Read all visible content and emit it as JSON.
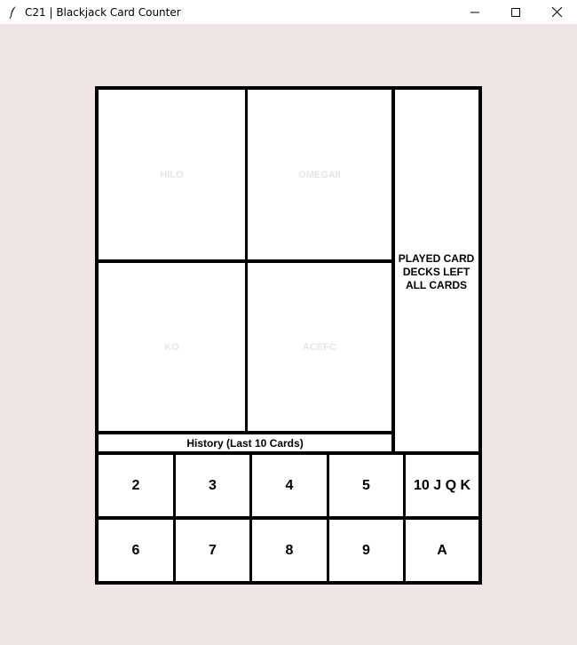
{
  "window": {
    "title": "C21 | Blackjack Card Counter",
    "minimize": "—",
    "maximize": "☐",
    "close": "✕"
  },
  "counters": {
    "hilo": "HILO",
    "omega": "OMEGAII",
    "ko": "KO",
    "acefc": "ACEFC"
  },
  "side": {
    "played_card": "PLAYED CARD",
    "decks_left": "DECKS LEFT",
    "all_cards": "ALL CARDS"
  },
  "history": {
    "label": "History (Last 10 Cards)"
  },
  "cards": {
    "row1": [
      "2",
      "3",
      "4",
      "5",
      "10 J Q K"
    ],
    "row2": [
      "6",
      "7",
      "8",
      "9",
      "A"
    ]
  }
}
